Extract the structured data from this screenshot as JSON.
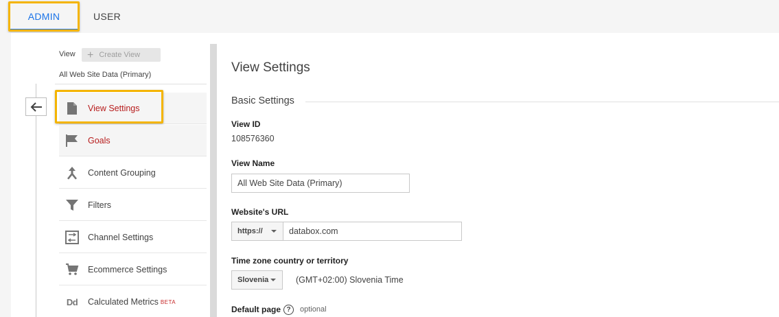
{
  "tabs": [
    {
      "label": "ADMIN",
      "active": true
    },
    {
      "label": "USER",
      "active": false
    }
  ],
  "sidebar": {
    "view_label": "View",
    "create_view_label": "Create View",
    "selected_view": "All Web Site Data (Primary)",
    "items": [
      {
        "label": "View Settings",
        "icon": "document-icon",
        "active": true
      },
      {
        "label": "Goals",
        "icon": "flag-icon",
        "active": false
      },
      {
        "label": "Content Grouping",
        "icon": "merge-icon",
        "active": false
      },
      {
        "label": "Filters",
        "icon": "filter-icon",
        "active": false
      },
      {
        "label": "Channel Settings",
        "icon": "channel-icon",
        "active": false
      },
      {
        "label": "Ecommerce Settings",
        "icon": "cart-icon",
        "active": false
      },
      {
        "label": "Calculated Metrics",
        "badge": "BETA",
        "icon": "dd-icon",
        "active": false
      }
    ]
  },
  "main": {
    "title": "View Settings",
    "section_title": "Basic Settings",
    "view_id_label": "View ID",
    "view_id_value": "108576360",
    "view_name_label": "View Name",
    "view_name_value": "All Web Site Data (Primary)",
    "website_url_label": "Website's URL",
    "protocol_value": "https://",
    "url_value": "databox.com",
    "timezone_label": "Time zone country or territory",
    "country_value": "Slovenia",
    "timezone_value": "(GMT+02:00) Slovenia Time",
    "default_page_label": "Default page",
    "default_page_help": "?",
    "default_page_optional": "optional"
  },
  "colors": {
    "accent_blue": "#1a73e8",
    "highlight": "#f4b400",
    "active_red": "#b71c1c"
  }
}
